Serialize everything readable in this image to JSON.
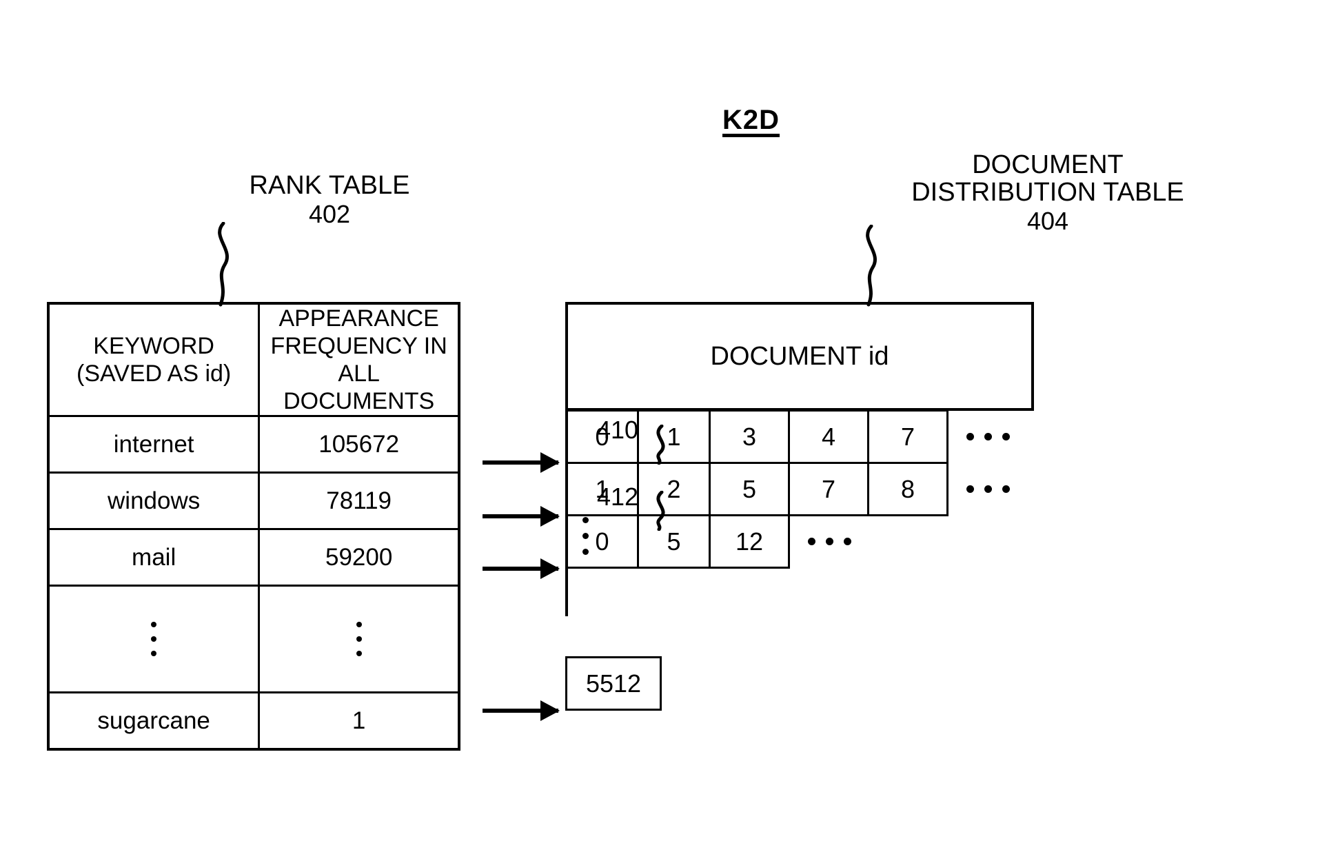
{
  "figure": {
    "k2d_label": "K2D",
    "rank_table": {
      "title_line1": "RANK TABLE",
      "ref": "402",
      "headers": {
        "keyword": "KEYWORD\n(SAVED AS id)",
        "frequency": "APPEARANCE\nFREQUENCY\nIN ALL\nDOCUMENTS"
      },
      "rows": [
        {
          "keyword": "internet",
          "frequency": "105672"
        },
        {
          "keyword": "windows",
          "frequency": "78119"
        },
        {
          "keyword": "mail",
          "frequency": "59200"
        },
        {
          "keyword": "sugarcane",
          "frequency": "1"
        }
      ]
    },
    "doc_table": {
      "title_line1": "DOCUMENT",
      "title_line2": "DISTRIBUTION TABLE",
      "ref": "404",
      "header": "DOCUMENT id",
      "rows": [
        {
          "cells": [
            "0",
            "1",
            "3",
            "4",
            "7"
          ],
          "trailing_ellipsis": true
        },
        {
          "cells": [
            "1",
            "2",
            "5",
            "7",
            "8"
          ],
          "trailing_ellipsis": true
        },
        {
          "cells": [
            "0",
            "5",
            "12"
          ],
          "trailing_ellipsis": true
        },
        {
          "cells": [
            "5512"
          ],
          "trailing_ellipsis": false
        }
      ]
    },
    "arrows": [
      {
        "ref": "410"
      },
      {
        "ref": "412"
      },
      {
        "ref": ""
      },
      {
        "ref": ""
      }
    ]
  }
}
